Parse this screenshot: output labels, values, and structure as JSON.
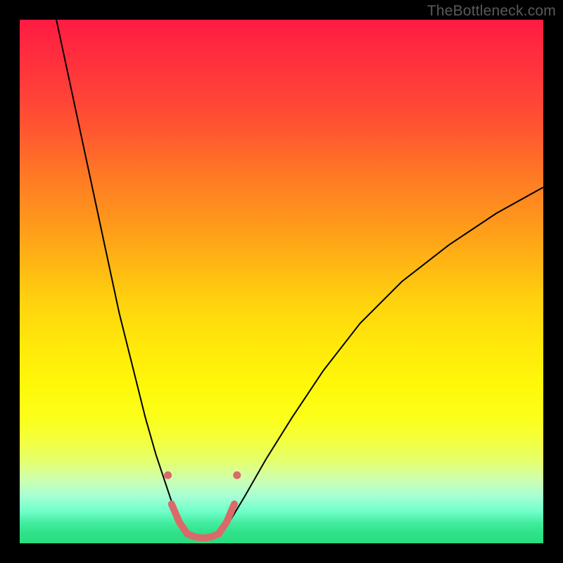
{
  "watermark": "TheBottleneck.com",
  "chart_data": {
    "type": "line",
    "title": "",
    "xlabel": "",
    "ylabel": "",
    "xlim": [
      0,
      100
    ],
    "ylim": [
      0,
      100
    ],
    "grid": false,
    "legend": false,
    "background_gradient": {
      "direction": "vertical",
      "stops": [
        {
          "pos": 0.0,
          "color": "#ff1b42"
        },
        {
          "pos": 0.25,
          "color": "#ff6a28"
        },
        {
          "pos": 0.5,
          "color": "#ffcf10"
        },
        {
          "pos": 0.75,
          "color": "#fcff1a"
        },
        {
          "pos": 0.9,
          "color": "#b8ffc0"
        },
        {
          "pos": 1.0,
          "color": "#29dd80"
        }
      ]
    },
    "series": [
      {
        "name": "left-branch",
        "stroke": "#000000",
        "stroke_width": 2,
        "x": [
          7,
          10,
          13,
          16,
          19,
          22,
          24,
          26,
          28,
          29,
          30,
          31,
          32
        ],
        "y": [
          100,
          86,
          72,
          58,
          44,
          32,
          24,
          17,
          11,
          8,
          5,
          3,
          1.5
        ]
      },
      {
        "name": "right-branch",
        "stroke": "#000000",
        "stroke_width": 2,
        "x": [
          38,
          40,
          43,
          47,
          52,
          58,
          65,
          73,
          82,
          91,
          100
        ],
        "y": [
          1.5,
          4,
          9,
          16,
          24,
          33,
          42,
          50,
          57,
          63,
          68
        ]
      },
      {
        "name": "valley-highlight",
        "stroke": "#d96a6a",
        "stroke_width": 10,
        "linecap": "round",
        "x": [
          29,
          30.5,
          32,
          33.5,
          35,
          36.5,
          38,
          39.5,
          41
        ],
        "y": [
          7.5,
          4,
          1.8,
          1.2,
          1.0,
          1.2,
          1.8,
          4,
          7.5
        ]
      }
    ],
    "markers": [
      {
        "name": "left-dot",
        "x": 28.3,
        "y": 13,
        "r": 5.5,
        "color": "#d96a6a"
      },
      {
        "name": "right-dot",
        "x": 41.5,
        "y": 13,
        "r": 5.5,
        "color": "#d96a6a"
      }
    ]
  }
}
